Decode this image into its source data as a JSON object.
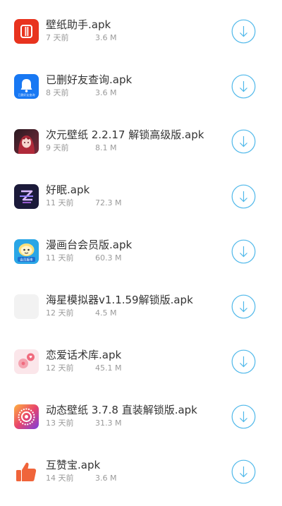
{
  "downloads": [
    {
      "name": "壁纸助手.apk",
      "age": "7 天前",
      "size": "3.6 M",
      "icon": "wallpaper-helper-icon",
      "icon_color": "#e8331e"
    },
    {
      "name": "已删好友查询.apk",
      "age": "8 天前",
      "size": "3.6 M",
      "icon": "chat-bubble-icon",
      "icon_color": "#1878f3",
      "icon_caption": "已删好友查询"
    },
    {
      "name": "次元壁纸 2.2.17 解锁高级版.apk",
      "age": "9 天前",
      "size": "8.1 M",
      "icon": "anime-girl-icon",
      "icon_color": "#7a2a3a"
    },
    {
      "name": "好眠.apk",
      "age": "11 天前",
      "size": "72.3 M",
      "icon": "sleep-zzz-icon",
      "icon_color": "#1b1a3a"
    },
    {
      "name": "漫画台会员版.apk",
      "age": "11 天前",
      "size": "60.3 M",
      "icon": "comic-character-icon",
      "icon_color": "#2aa6e6",
      "icon_caption": "会员版本"
    },
    {
      "name": "海星模拟器v1.1.59解锁版.apk",
      "age": "12 天前",
      "size": "4.5 M",
      "icon": "blank-app-icon",
      "icon_color": "#f2f2f2"
    },
    {
      "name": "恋爱话术库.apk",
      "age": "12 天前",
      "size": "45.1 M",
      "icon": "love-chat-icon",
      "icon_color": "#f06b7e"
    },
    {
      "name": "动态壁纸 3.7.8 直装解锁版.apk",
      "age": "13 天前",
      "size": "31.3 M",
      "icon": "colorful-ring-icon",
      "icon_color": "#e8456b"
    },
    {
      "name": "互赞宝.apk",
      "age": "14 天前",
      "size": "3.6 M",
      "icon": "thumbs-up-icon",
      "icon_color": "#f0643a"
    }
  ],
  "download_button": {
    "icon": "download-arrow-icon",
    "color": "#4fb8ea"
  }
}
